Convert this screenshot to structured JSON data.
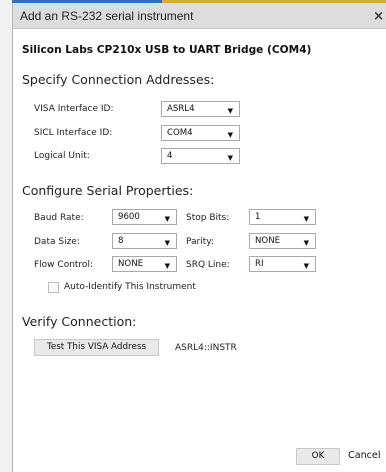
{
  "dialog": {
    "title": "Add an RS-232 serial instrument",
    "close_label": "×",
    "device_name": "Silicon Labs CP210x USB to UART Bridge (COM4)"
  },
  "connection": {
    "heading": "Specify Connection Addresses:",
    "visa_label": "VISA Interface ID:",
    "visa_value": "ASRL4",
    "sicl_label": "SICL Interface ID:",
    "sicl_value": "COM4",
    "unit_label": "Logical Unit:",
    "unit_value": "4"
  },
  "serial": {
    "heading": "Configure Serial Properties:",
    "baud_label": "Baud Rate:",
    "baud_value": "9600",
    "stop_label": "Stop Bits:",
    "stop_value": "1",
    "data_label": "Data Size:",
    "data_value": "8",
    "parity_label": "Parity:",
    "parity_value": "NONE",
    "flow_label": "Flow Control:",
    "flow_value": "NONE",
    "srq_label": "SRQ Line:",
    "srq_value": "RI",
    "auto_identify_label": "Auto-Identify This Instrument",
    "auto_identify_checked": false
  },
  "verify": {
    "heading": "Verify Connection:",
    "test_button": "Test This VISA Address",
    "address": "ASRL4::INSTR"
  },
  "footer": {
    "ok": "OK",
    "cancel": "Cancel"
  },
  "icons": {
    "dropdown": "chevron-down-icon",
    "close": "close-icon"
  }
}
